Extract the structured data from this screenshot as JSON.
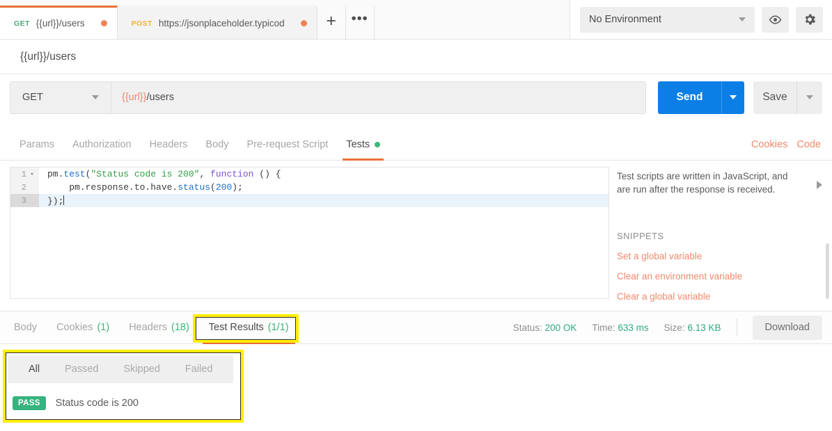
{
  "tabbar": {
    "request_tabs": [
      {
        "verb": "GET",
        "name": "{{url}}/users",
        "unsaved": true,
        "active": true
      },
      {
        "verb": "POST",
        "name": "https://jsonplaceholder.typicod",
        "unsaved": true,
        "active": false
      }
    ],
    "new_tab_label": "+",
    "more_label": "•••"
  },
  "environment": {
    "selected": "No Environment",
    "eye_icon": "eye-icon",
    "gear_icon": "gear-icon"
  },
  "request": {
    "name": "{{url}}/users",
    "method": "GET",
    "url_variable": "{{url}}",
    "url_rest": "/users",
    "send_label": "Send",
    "save_label": "Save"
  },
  "request_tabs": {
    "items": [
      {
        "label": "Params",
        "active": false,
        "dot": false
      },
      {
        "label": "Authorization",
        "active": false,
        "dot": false
      },
      {
        "label": "Headers",
        "active": false,
        "dot": false
      },
      {
        "label": "Body",
        "active": false,
        "dot": false
      },
      {
        "label": "Pre-request Script",
        "active": false,
        "dot": false
      },
      {
        "label": "Tests",
        "active": true,
        "dot": true
      }
    ],
    "cookies_link": "Cookies",
    "code_link": "Code"
  },
  "editor": {
    "lines": [
      {
        "number": "1",
        "foldable": true,
        "active": false,
        "tokens": [
          {
            "t": "pm.",
            "c": "plain"
          },
          {
            "t": "test",
            "c": "fn"
          },
          {
            "t": "(",
            "c": "plain"
          },
          {
            "t": "\"Status code is 200\"",
            "c": "str"
          },
          {
            "t": ", ",
            "c": "plain"
          },
          {
            "t": "function",
            "c": "kw"
          },
          {
            "t": " () {",
            "c": "plain"
          }
        ]
      },
      {
        "number": "2",
        "foldable": false,
        "active": false,
        "tokens": [
          {
            "t": "    pm.response.to.have.",
            "c": "plain"
          },
          {
            "t": "status",
            "c": "fn"
          },
          {
            "t": "(",
            "c": "plain"
          },
          {
            "t": "200",
            "c": "num"
          },
          {
            "t": ");",
            "c": "plain"
          }
        ]
      },
      {
        "number": "3",
        "foldable": false,
        "active": true,
        "tokens": [
          {
            "t": "});",
            "c": "plain"
          }
        ]
      }
    ]
  },
  "snippets": {
    "description": "Test scripts are written in JavaScript, and are run after the response is received.",
    "heading": "SNIPPETS",
    "items": [
      "Set a global variable",
      "Clear an environment variable",
      "Clear a global variable"
    ]
  },
  "response": {
    "tabs": [
      {
        "label": "Body",
        "count": "",
        "active": false
      },
      {
        "label": "Cookies",
        "count": "(1)",
        "active": false
      },
      {
        "label": "Headers",
        "count": "(18)",
        "active": false
      },
      {
        "label": "Test Results",
        "count": "(1/1)",
        "active": true
      }
    ],
    "status_label": "Status:",
    "status_value": "200 OK",
    "time_label": "Time:",
    "time_value": "633 ms",
    "size_label": "Size:",
    "size_value": "6.13 KB",
    "download_label": "Download"
  },
  "test_results": {
    "filters": [
      {
        "label": "All",
        "active": true
      },
      {
        "label": "Passed",
        "active": false
      },
      {
        "label": "Skipped",
        "active": false
      },
      {
        "label": "Failed",
        "active": false
      }
    ],
    "rows": [
      {
        "status": "PASS",
        "name": "Status code is 200"
      }
    ]
  },
  "colors": {
    "accent_orange": "#e8703a",
    "variable_orange": "#ef8a6b",
    "send_blue": "#0b7fe5",
    "pass_green": "#36b37e",
    "meta_green": "#2fab7a",
    "get_green": "#4aab78",
    "post_yellow": "#eeb42c",
    "annotation_yellow": "#ffee00"
  }
}
